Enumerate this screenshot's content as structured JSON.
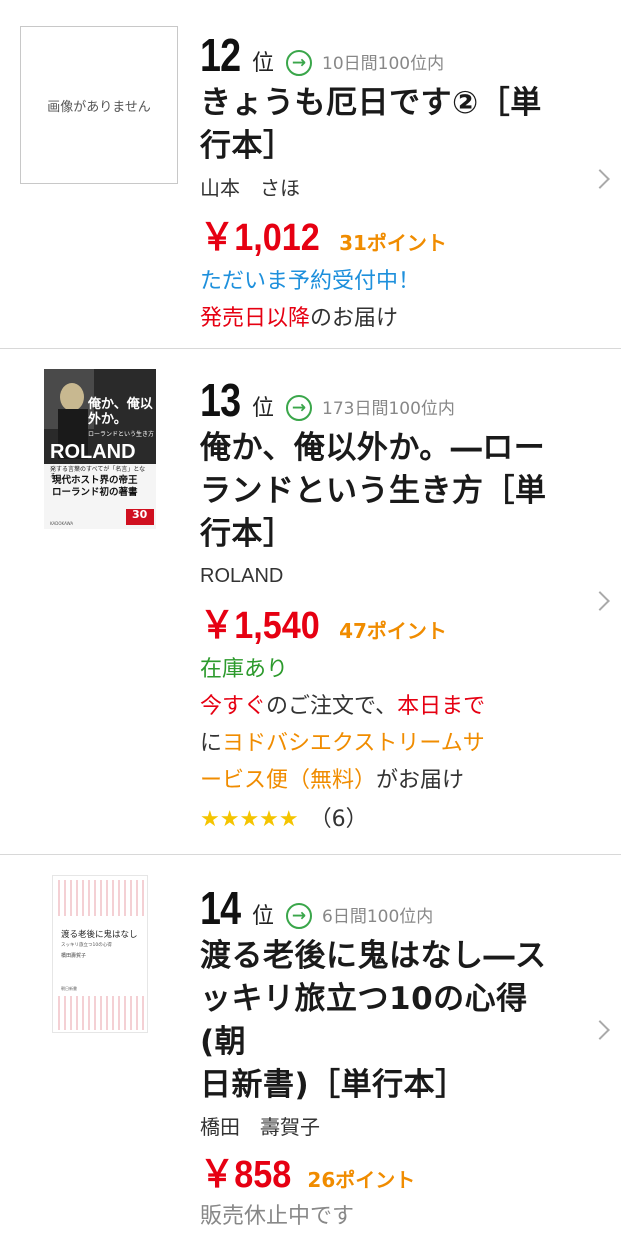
{
  "items": [
    {
      "rank": "12",
      "rank_unit": "位",
      "rank_meta": "10日間100位内",
      "image_text": "画像がありません",
      "title_lines": [
        "きょうも厄日です②［単",
        "行本］"
      ],
      "author": "山本　さほ",
      "price": "￥1,012",
      "points": "31ポイント",
      "status": "ただいま予約受付中！",
      "delivery_red": "発売日以降",
      "delivery_rest": "のお届け"
    },
    {
      "rank": "13",
      "rank_unit": "位",
      "rank_meta": "173日間100位内",
      "cover": {
        "title": "俺か、俺以外か。",
        "subtitle": "ローランドという生き方",
        "brand": "ROLAND",
        "tag1": "発する言葉のすべてが「名言」となる",
        "tag2": "現代ホスト界の帝王",
        "tag3": "ローランド初の著書",
        "badge": "30",
        "publisher": "KADOKAWA"
      },
      "title_lines": [
        "俺か、俺以外か。―ロー",
        "ランドという生き方［単",
        "行本］"
      ],
      "author": "ROLAND",
      "price": "￥1,540",
      "points": "47ポイント",
      "status": "在庫あり",
      "order_red1": "今すぐ",
      "order_mid": "のご注文で、",
      "order_red2": "本日まで",
      "order_ni": "に",
      "order_orange": "ヨドバシエクストリームサ",
      "order_orange2": "ービス便（無料）",
      "order_tail": "がお届け",
      "stars": "★★★★★",
      "review_count": "（6）"
    },
    {
      "rank": "14",
      "rank_unit": "位",
      "rank_meta": "6日間100位内",
      "cover": {
        "title": "渡る老後に鬼はなし",
        "subtitle": "スッキリ旅立つ10の心得",
        "author": "橋田壽賀子",
        "series": "朝日新書"
      },
      "title_lines": [
        "渡る老後に鬼はなし―ス",
        "ッキリ旅立つ10の心得(朝",
        "日新書)［単行本］"
      ],
      "author": "橋田　壽賀子",
      "price": "￥858",
      "points": "26ポイント",
      "status": "販売休止中です"
    }
  ],
  "colors": {
    "price": "#e60012",
    "points": "#f08c00",
    "status_blue": "#1e90dc",
    "status_green": "#2c9a2c",
    "rank_arrow": "#3aa64a"
  },
  "icons": {
    "rank_trend": "arrow-right-circle-icon",
    "chevron": "chevron-right-icon",
    "star": "star-icon"
  }
}
